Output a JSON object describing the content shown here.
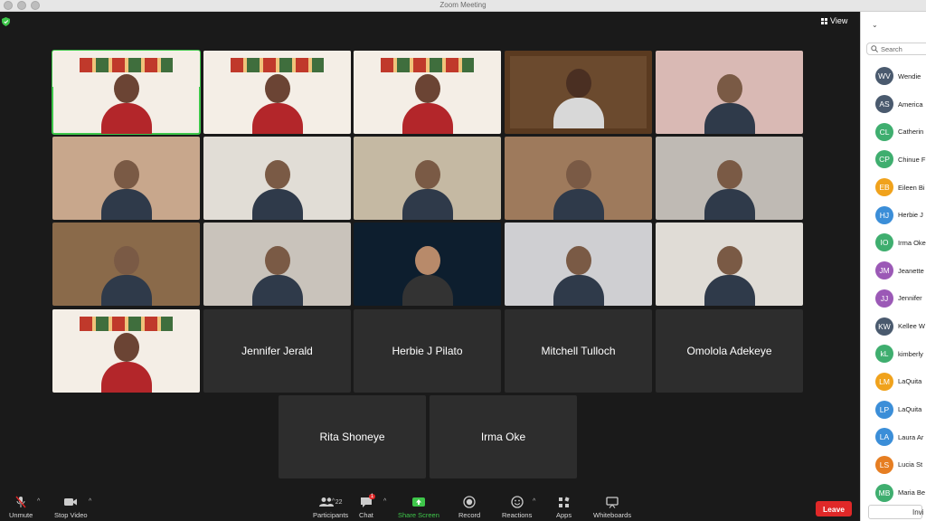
{
  "window": {
    "title": "Zoom Meeting"
  },
  "header": {
    "view_label": "View"
  },
  "video_grid": [
    {
      "name": "",
      "active": true,
      "scene": "banner"
    },
    {
      "name": "",
      "scene": "banner"
    },
    {
      "name": "",
      "scene": "banner"
    },
    {
      "name": "",
      "scene": "tv"
    },
    {
      "name": "",
      "scene": "room"
    },
    {
      "name": "",
      "scene": "room"
    },
    {
      "name": "",
      "scene": "room"
    },
    {
      "name": "",
      "scene": "room"
    },
    {
      "name": "",
      "scene": "room"
    },
    {
      "name": "",
      "scene": "room"
    },
    {
      "name": "",
      "scene": "room"
    },
    {
      "name": "",
      "scene": "room"
    },
    {
      "name": "",
      "scene": "space"
    },
    {
      "name": "",
      "scene": "room"
    },
    {
      "name": "",
      "scene": "room"
    },
    {
      "name": "",
      "scene": "banner"
    },
    {
      "name": "Jennifer Jerald",
      "scene": "name"
    },
    {
      "name": "Herbie J Pilato",
      "scene": "name"
    },
    {
      "name": "Mitchell Tulloch",
      "scene": "name"
    },
    {
      "name": "Omolola Adekeye",
      "scene": "name"
    },
    {
      "name": "Rita Shoneye",
      "scene": "name"
    },
    {
      "name": "Irma Oke",
      "scene": "name"
    }
  ],
  "toolbar": {
    "unmute": "Unmute",
    "stop_video": "Stop Video",
    "participants": "Participants",
    "participants_count": "22",
    "chat": "Chat",
    "chat_badge": "1",
    "share_screen": "Share Screen",
    "record": "Record",
    "reactions": "Reactions",
    "apps": "Apps",
    "whiteboards": "Whiteboards",
    "leave": "Leave"
  },
  "panel": {
    "search_placeholder": "Search",
    "invite_label": "Invi",
    "participants": [
      {
        "initials": "WV",
        "name": "Wendie ",
        "color": "#4a5a6e"
      },
      {
        "initials": "AS",
        "name": "America",
        "color": "#4a5a6e"
      },
      {
        "initials": "CL",
        "name": "Catherin",
        "color": "#3fae6f"
      },
      {
        "initials": "CP",
        "name": "Chinue F",
        "color": "#3fae6f"
      },
      {
        "initials": "EB",
        "name": "Eileen Bi",
        "color": "#f0a21c"
      },
      {
        "initials": "HJ",
        "name": "Herbie J",
        "color": "#3b8ed8"
      },
      {
        "initials": "IO",
        "name": "Irma Oke",
        "color": "#3fae6f"
      },
      {
        "initials": "JM",
        "name": "Jeanette",
        "color": "#9b59b6"
      },
      {
        "initials": "JJ",
        "name": "Jennifer",
        "color": "#9b59b6"
      },
      {
        "initials": "KW",
        "name": "Kellee W",
        "color": "#4a5a6e"
      },
      {
        "initials": "kL",
        "name": "kimberly",
        "color": "#3fae6f"
      },
      {
        "initials": "LM",
        "name": "LaQuita",
        "color": "#f0a21c"
      },
      {
        "initials": "LP",
        "name": "LaQuita",
        "color": "#3b8ed8"
      },
      {
        "initials": "LA",
        "name": "Laura Ar",
        "color": "#3b8ed8"
      },
      {
        "initials": "LS",
        "name": "Lucia St",
        "color": "#e67e22"
      },
      {
        "initials": "MB",
        "name": "Maria Be",
        "color": "#3fae6f"
      }
    ]
  }
}
